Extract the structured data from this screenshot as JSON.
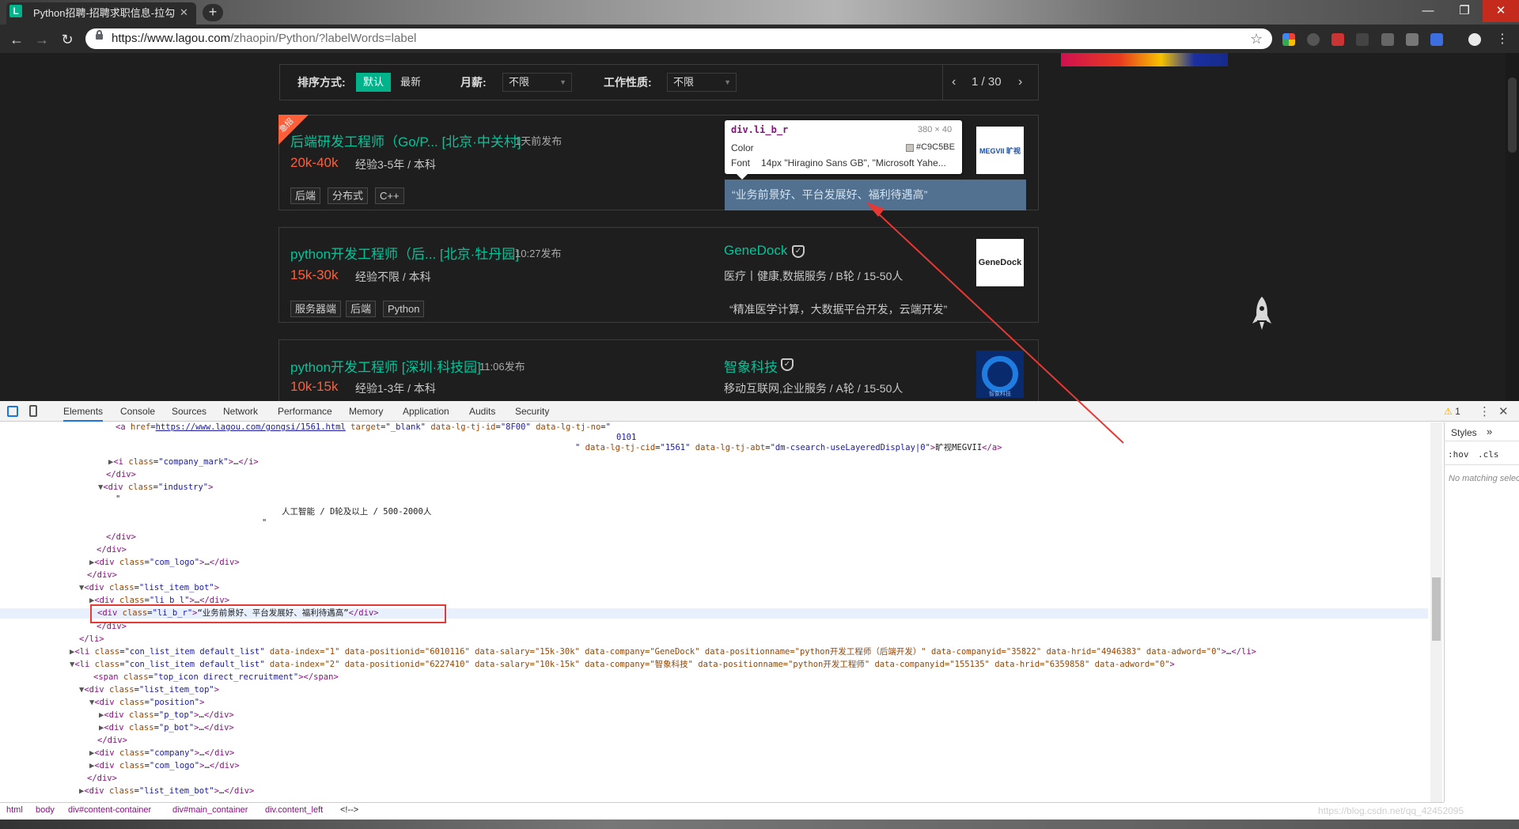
{
  "browser": {
    "tab_title": "Python招聘-招聘求职信息-拉勾",
    "tab_favicon": "L",
    "url_host": "https://www.lagou.com",
    "url_path": "/zhaopin/Python/?labelWords=label"
  },
  "filters": {
    "sort_label": "排序方式:",
    "sort_default": "默认",
    "sort_latest": "最新",
    "salary_label": "月薪:",
    "salary_value": "不限",
    "jobtype_label": "工作性质:",
    "jobtype_value": "不限",
    "page_current": "1",
    "page_total": "30"
  },
  "jobs": [
    {
      "hot_badge": "急招",
      "title": "后端研发工程师（Go/P... [北京·中关村]",
      "time": "1天前发布",
      "salary": "20k-40k",
      "experience": "经验3-5年 / 本科",
      "tags": [
        "后端",
        "分布式",
        "C++"
      ],
      "company": "旷视MEGVII",
      "logo_text": "MEGVII 旷视",
      "description": "“业务前景好、平台发展好、福利待遇高”"
    },
    {
      "title": "python开发工程师（后... [北京·牡丹园]",
      "time": "10:27发布",
      "salary": "15k-30k",
      "experience": "经验不限 / 本科",
      "tags": [
        "服务器端",
        "后端",
        "Python"
      ],
      "company": "GeneDock",
      "industry": "医疗丨健康,数据服务 / B轮 / 15-50人",
      "logo_text": "GeneDock",
      "description": "“精准医学计算，大数据平台开发，云端开发”"
    },
    {
      "title": "python开发工程师 [深圳·科技园]",
      "time": "11:06发布",
      "salary": "10k-15k",
      "experience": "经验1-3年 / 本科",
      "company": "智象科技",
      "industry": "移动互联网,企业服务 / A轮 / 15-50人",
      "logo_text": "智象科技"
    }
  ],
  "tooltip": {
    "selector": "div.li_b_r",
    "size": "380 × 40",
    "color_label": "Color",
    "color_value": "#C9C5BE",
    "font_label": "Font",
    "font_value": "14px \"Hiragino Sans GB\", \"Microsoft Yahe..."
  },
  "devtools": {
    "tabs": [
      "Elements",
      "Console",
      "Sources",
      "Network",
      "Performance",
      "Memory",
      "Application",
      "Audits",
      "Security"
    ],
    "warnings": "1",
    "styles_tab": "Styles",
    "styles_more": "»",
    "hov": ":hov",
    "cls": ".cls",
    "no_matching": "No matching selector",
    "breadcrumbs": [
      "html",
      "body",
      "div#content-container",
      "div#main_container",
      "div.content_left",
      "<!-->"
    ],
    "watermark": "https://blog.csdn.net/qq_42452095",
    "dom_text": {
      "href_url": "https://www.lagou.com/gongsi/1561.html",
      "tj_no": "0101",
      "company_link_text": "旷视MEGVII",
      "industry_text": "人工智能 / D轮及以上 / 500-2000人",
      "selected_text": "“业务前景好、平台发展好、福利待遇高”",
      "li1_attrs": "data-index=\"1\" data-positionid=\"6010116\" data-salary=\"15k-30k\" data-company=\"GeneDock\" data-positionname=\"python开发工程师（后端开发）\" data-companyid=\"35822\" data-hrid=\"4946383\" data-adword=\"0\"",
      "li2_attrs": "data-index=\"2\" data-positionid=\"6227410\" data-salary=\"10k-15k\" data-company=\"智象科技\" data-positionname=\"python开发工程师\" data-companyid=\"155135\" data-hrid=\"6359858\" data-adword=\"0\""
    }
  }
}
